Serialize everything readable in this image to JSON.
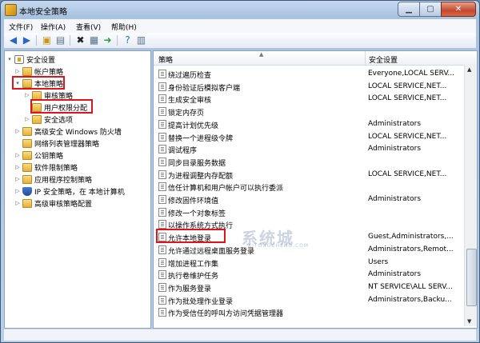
{
  "window": {
    "title": "本地安全策略"
  },
  "menu": [
    "文件(F)",
    "操作(A)",
    "查看(V)",
    "帮助(H)"
  ],
  "tree": [
    {
      "label": "安全设置",
      "arrow": "▾",
      "icon": "lock"
    },
    {
      "label": "帐户策略",
      "arrow": "▷",
      "icon": "folder"
    },
    {
      "label": "本地策略",
      "arrow": "▾",
      "icon": "folder"
    },
    {
      "label": "审核策略",
      "arrow": "▷",
      "icon": "folder"
    },
    {
      "label": "用户权限分配",
      "arrow": "",
      "icon": "folder"
    },
    {
      "label": "安全选项",
      "arrow": "▷",
      "icon": "folder"
    },
    {
      "label": "高级安全 Windows 防火墙",
      "arrow": "▷",
      "icon": "folder"
    },
    {
      "label": "网络列表管理器策略",
      "arrow": "",
      "icon": "folder"
    },
    {
      "label": "公钥策略",
      "arrow": "▷",
      "icon": "folder"
    },
    {
      "label": "软件限制策略",
      "arrow": "▷",
      "icon": "folder"
    },
    {
      "label": "应用程序控制策略",
      "arrow": "▷",
      "icon": "folder"
    },
    {
      "label": "IP 安全策略，在 本地计算机",
      "arrow": "▷",
      "icon": "shield"
    },
    {
      "label": "高级审核策略配置",
      "arrow": "▷",
      "icon": "folder"
    }
  ],
  "table": {
    "columns": [
      "策略",
      "安全设置"
    ],
    "rows": [
      {
        "policy": "绕过遍历检查",
        "setting": "Everyone,LOCAL SERV..."
      },
      {
        "policy": "身份验证后模拟客户端",
        "setting": "LOCAL SERVICE,NET..."
      },
      {
        "policy": "生成安全审核",
        "setting": "LOCAL SERVICE,NET..."
      },
      {
        "policy": "锁定内存页",
        "setting": ""
      },
      {
        "policy": "提高计划优先级",
        "setting": "Administrators"
      },
      {
        "policy": "替换一个进程级令牌",
        "setting": "LOCAL SERVICE,NET..."
      },
      {
        "policy": "调试程序",
        "setting": "Administrators"
      },
      {
        "policy": "同步目录服务数据",
        "setting": ""
      },
      {
        "policy": "为进程调整内存配额",
        "setting": "LOCAL SERVICE,NET..."
      },
      {
        "policy": "信任计算机和用户帐户可以执行委派",
        "setting": ""
      },
      {
        "policy": "修改固件环境值",
        "setting": "Administrators"
      },
      {
        "policy": "修改一个对象标签",
        "setting": ""
      },
      {
        "policy": "以操作系统方式执行",
        "setting": ""
      },
      {
        "policy": "允许本地登录",
        "setting": "Guest,Administrators,..."
      },
      {
        "policy": "允许通过远程桌面服务登录",
        "setting": "Administrators,Remot..."
      },
      {
        "policy": "增加进程工作集",
        "setting": "Users"
      },
      {
        "policy": "执行卷维护任务",
        "setting": "Administrators"
      },
      {
        "policy": "作为服务登录",
        "setting": "NT SERVICE\\ALL SERV..."
      },
      {
        "policy": "作为批处理作业登录",
        "setting": "Administrators,Backu..."
      },
      {
        "policy": "作为受信任的呼叫方访问凭据管理器",
        "setting": ""
      }
    ]
  },
  "watermark": {
    "text": "系统城",
    "sub": "XITONGCHENG.COM"
  },
  "colors": {
    "highlight_box": "#e0121a"
  }
}
